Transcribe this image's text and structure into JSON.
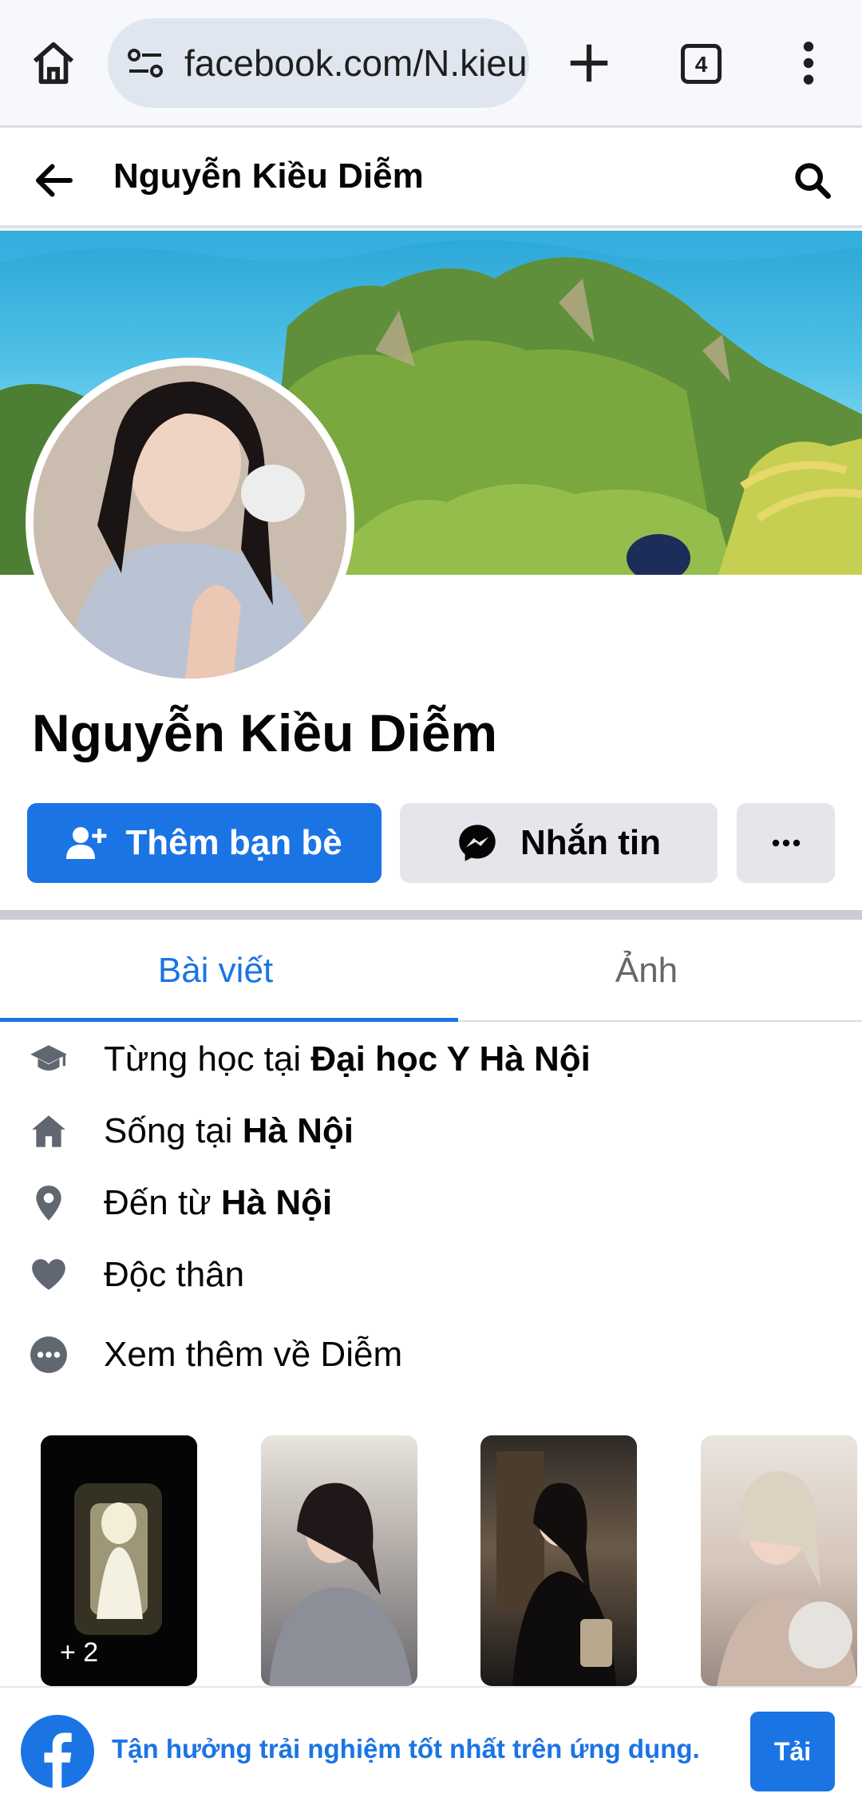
{
  "browser": {
    "url": "facebook.com/N.kieu",
    "tab_count": "4"
  },
  "header": {
    "title": "Nguyễn Kiều Diễm"
  },
  "profile": {
    "name": "Nguyễn Kiều Diễm",
    "add_friend_label": "Thêm bạn bè",
    "message_label": "Nhắn tin"
  },
  "tabs": [
    {
      "label": "Bài viết",
      "active": true
    },
    {
      "label": "Ảnh",
      "active": false
    }
  ],
  "intro": {
    "studied": {
      "prefix": "Từng học tại ",
      "value": "Đại học Y Hà Nội",
      "icon": "graduation-cap-icon"
    },
    "lives": {
      "prefix": "Sống tại ",
      "value": "Hà Nội",
      "icon": "home-icon"
    },
    "from": {
      "prefix": "Đến từ ",
      "value": "Hà Nội",
      "icon": "location-pin-icon"
    },
    "relationship": {
      "text": "Độc thân",
      "icon": "heart-icon"
    },
    "see_more": {
      "text": "Xem thêm về Diễm",
      "icon": "more-dots-icon"
    }
  },
  "photos": {
    "first_count": "+ 2"
  },
  "banner": {
    "text": "Tận hưởng trải nghiệm tốt nhất trên ứng dụng.",
    "button_label": "Tải"
  },
  "colors": {
    "accent": "#1b74e4",
    "secondary_button": "#e4e6eb",
    "muted_text": "#65676b"
  }
}
